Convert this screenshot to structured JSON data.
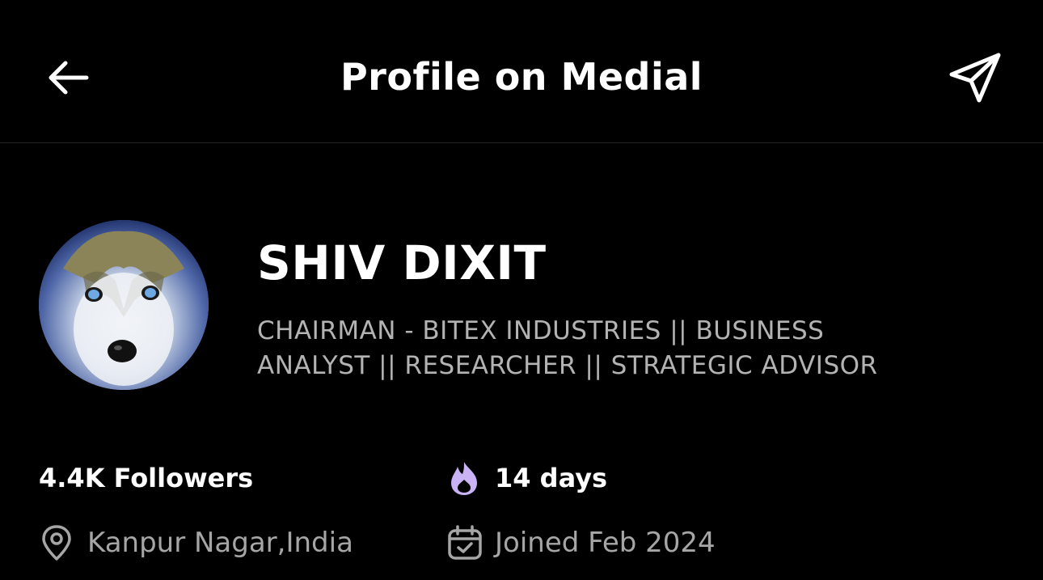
{
  "header": {
    "title": "Profile on Medial",
    "back_icon": "arrow-left-icon",
    "share_icon": "send-icon"
  },
  "profile": {
    "name": "SHIV DIXIT",
    "bio_lines": [
      "CHAIRMAN - BITEX INDUSTRIES || BUSINESS",
      "ANALYST || RESEARCHER || STRATEGIC ADVISOR"
    ],
    "avatar_icon": "husky-avatar",
    "followers": "4.4K Followers",
    "streak": "14 days",
    "streak_icon": "flame-icon",
    "location": "Kanpur Nagar,India",
    "location_icon": "map-pin-icon",
    "joined": "Joined Feb 2024",
    "joined_icon": "calendar-check-icon"
  },
  "colors": {
    "background": "#000000",
    "text_primary": "#ffffff",
    "text_secondary": "#b3b3b3",
    "flame_accent": "#c9b3f5",
    "divider": "#262626"
  }
}
